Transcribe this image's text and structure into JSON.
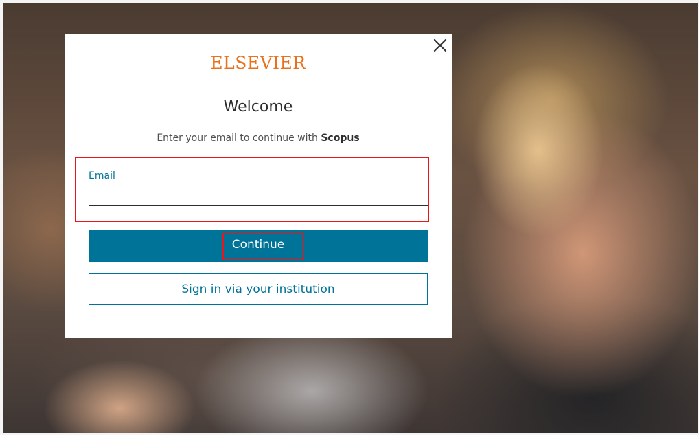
{
  "brand": {
    "name": "ELSEVIER",
    "color": "#e9711c"
  },
  "dialog": {
    "title": "Welcome",
    "subtitle_prefix": "Enter your email to continue with",
    "product_name": "Scopus",
    "close_icon": "close-icon"
  },
  "email": {
    "label": "Email",
    "value": "",
    "placeholder": ""
  },
  "buttons": {
    "continue_label": "Continue",
    "institution_label": "Sign in via your institution"
  },
  "colors": {
    "primary": "#007398",
    "highlight": "#e8171e"
  }
}
